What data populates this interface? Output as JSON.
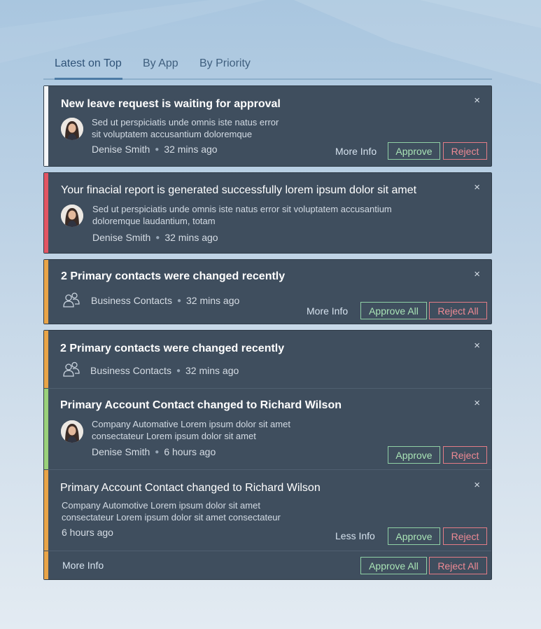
{
  "tabs": [
    {
      "label": "Latest on Top"
    },
    {
      "label": "By App"
    },
    {
      "label": "By Priority"
    }
  ],
  "colors": {
    "stripe_white": "#f4f6f8",
    "stripe_red": "#e25563",
    "stripe_orange": "#e9a448",
    "stripe_green": "#9ad17b"
  },
  "notifications": [
    {
      "title": "New leave request is waiting for approval",
      "desc_line1": "Sed ut perspiciatis unde omnis iste natus error",
      "desc_line2": "sit voluptatem accusantium doloremque",
      "author": "Denise Smith",
      "time": "32 mins ago",
      "more_info": "More Info",
      "approve": "Approve",
      "reject": "Reject",
      "close": "×"
    },
    {
      "title": "Your finacial report is generated successfully lorem ipsum dolor sit amet",
      "desc_line1": "Sed ut perspiciatis unde omnis iste natus error sit voluptatem accusantium",
      "desc_line2": "doloremque laudantium, totam",
      "author": "Denise Smith",
      "time": "32 mins ago",
      "close": "×"
    },
    {
      "title": "2 Primary contacts were changed recently",
      "source": "Business Contacts",
      "time": "32 mins ago",
      "more_info": "More Info",
      "approve_all": "Approve All",
      "reject_all": "Reject All",
      "close": "×"
    }
  ],
  "group": {
    "title": "2 Primary contacts were changed recently",
    "source": "Business Contacts",
    "time": "32 mins ago",
    "close": "×",
    "items": [
      {
        "title": "Primary Account Contact changed to Richard Wilson",
        "desc_line1": "Company Automative Lorem ipsum dolor sit amet",
        "desc_line2": "consectateur Lorem ipsum dolor sit amet",
        "author": "Denise Smith",
        "time": "6 hours ago",
        "approve": "Approve",
        "reject": "Reject",
        "close": "×"
      },
      {
        "title": "Primary Account Contact changed to Richard Wilson",
        "desc_line1": "Company Automotive Lorem ipsum dolor sit amet",
        "desc_line2": "consectateur Lorem ipsum dolor sit amet consectateur",
        "time": "6 hours ago",
        "less_info": "Less Info",
        "approve": "Approve",
        "reject": "Reject",
        "close": "×"
      }
    ],
    "footer": {
      "more_info": "More Info",
      "approve_all": "Approve All",
      "reject_all": "Reject All"
    }
  }
}
